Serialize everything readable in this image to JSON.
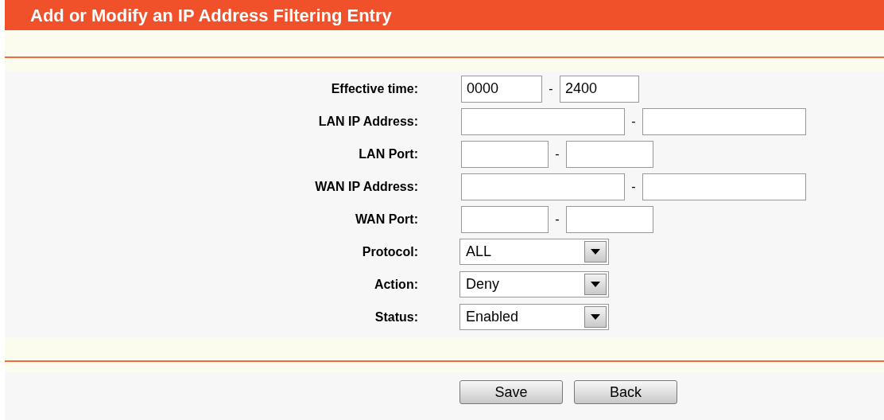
{
  "title": "Add or Modify an IP Address Filtering Entry",
  "fields": [
    {
      "label": "Effective time:",
      "kind": "time",
      "from": "0000",
      "to": "2400",
      "separator": "-"
    },
    {
      "label": "LAN IP Address:",
      "kind": "ip",
      "separator": "-"
    },
    {
      "label": "LAN Port:",
      "kind": "port",
      "separator": "-"
    },
    {
      "label": "WAN IP Address:",
      "kind": "ip",
      "separator": "-"
    },
    {
      "label": "WAN Port:",
      "kind": "port",
      "separator": "-"
    },
    {
      "label": "Protocol:",
      "kind": "select",
      "value": "ALL"
    },
    {
      "label": "Action:",
      "kind": "select",
      "value": "Deny"
    },
    {
      "label": "Status:",
      "kind": "select",
      "value": "Enabled"
    }
  ],
  "buttons": [
    "Save",
    "Back"
  ]
}
